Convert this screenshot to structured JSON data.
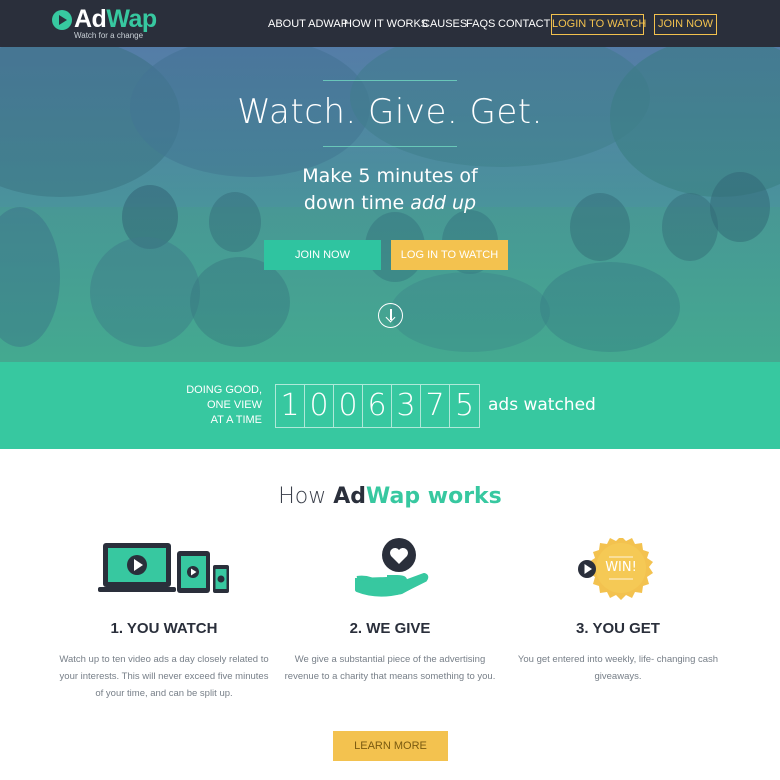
{
  "brand": {
    "name_part1": "Ad",
    "name_part2": "Wap",
    "tagline": "Watch for a change"
  },
  "nav": {
    "links": [
      "ABOUT ADWAP",
      "HOW IT WORKS",
      "CAUSES",
      "FAQS",
      "CONTACT"
    ],
    "login_label": "LOGIN TO WATCH",
    "join_label": "JOIN NOW"
  },
  "hero": {
    "title": "Watch. Give. Get.",
    "subtitle_line1": "Make 5 minutes of",
    "subtitle_line2_plain": "down time ",
    "subtitle_line2_em": "add up",
    "join_label": "JOIN NOW",
    "login_label": "LOG IN TO WATCH"
  },
  "counter": {
    "tagline_lines": [
      "DOING GOOD,",
      "ONE VIEW",
      "AT A TIME"
    ],
    "digits": [
      "1",
      "0",
      "0",
      "6",
      "3",
      "7",
      "5"
    ],
    "suffix": "ads watched"
  },
  "how": {
    "title_prefix": "How ",
    "title_ad": "Ad",
    "title_wap": "Wap works",
    "steps": [
      {
        "heading": "1. YOU WATCH",
        "text": "Watch up to ten video ads a day closely related to your interests. This will never exceed five minutes of your time, and can be split up."
      },
      {
        "heading": "2. WE GIVE",
        "text": "We give a substantial piece of the advertising revenue to a charity that means something to you."
      },
      {
        "heading": "3. YOU GET",
        "text": "You get entered into weekly, life- changing cash giveaways.",
        "badge": "WIN!"
      }
    ],
    "learn_more_label": "LEARN MORE"
  },
  "colors": {
    "nav_bg": "#2a2f3b",
    "teal": "#37c8a0",
    "yellow": "#f3c24f"
  }
}
